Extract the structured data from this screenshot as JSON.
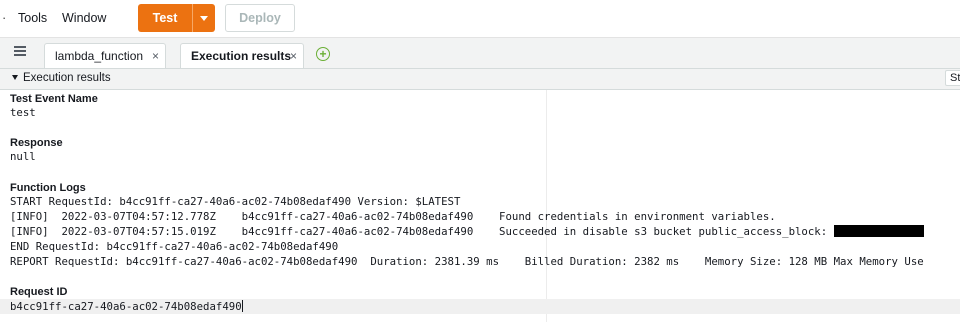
{
  "menubar": {
    "items": [
      "Tools",
      "Window"
    ],
    "test_label": "Test",
    "deploy_label": "Deploy"
  },
  "tabs": [
    {
      "label": "lambda_function",
      "close": "×"
    },
    {
      "label": "Execution results",
      "close": "×"
    }
  ],
  "panel": {
    "title": "Execution results",
    "right_label": "St"
  },
  "results": {
    "test_event_name_label": "Test Event Name",
    "test_event_name": "test",
    "response_label": "Response",
    "response": "null",
    "function_logs_label": "Function Logs",
    "logs": [
      "START RequestId: b4cc91ff-ca27-40a6-ac02-74b08edaf490 Version: $LATEST",
      "[INFO]  2022-03-07T04:57:12.778Z    b4cc91ff-ca27-40a6-ac02-74b08edaf490    Found credentials in environment variables.",
      "[INFO]  2022-03-07T04:57:15.019Z    b4cc91ff-ca27-40a6-ac02-74b08edaf490    Succeeded in disable s3 bucket public_access_block: ",
      "END RequestId: b4cc91ff-ca27-40a6-ac02-74b08edaf490",
      "REPORT RequestId: b4cc91ff-ca27-40a6-ac02-74b08edaf490  Duration: 2381.39 ms    Billed Duration: 2382 ms    Memory Size: 128 MB Max Memory Use"
    ],
    "request_id_label": "Request ID",
    "request_id": "b4cc91ff-ca27-40a6-ac02-74b08edaf490"
  },
  "colors": {
    "accent": "#ec7211",
    "add_tab": "#6aaf35"
  },
  "icons": {
    "tab_menu": "list-icon",
    "add_tab": "plus-circle-icon",
    "dropdown": "chevron-down-icon"
  }
}
